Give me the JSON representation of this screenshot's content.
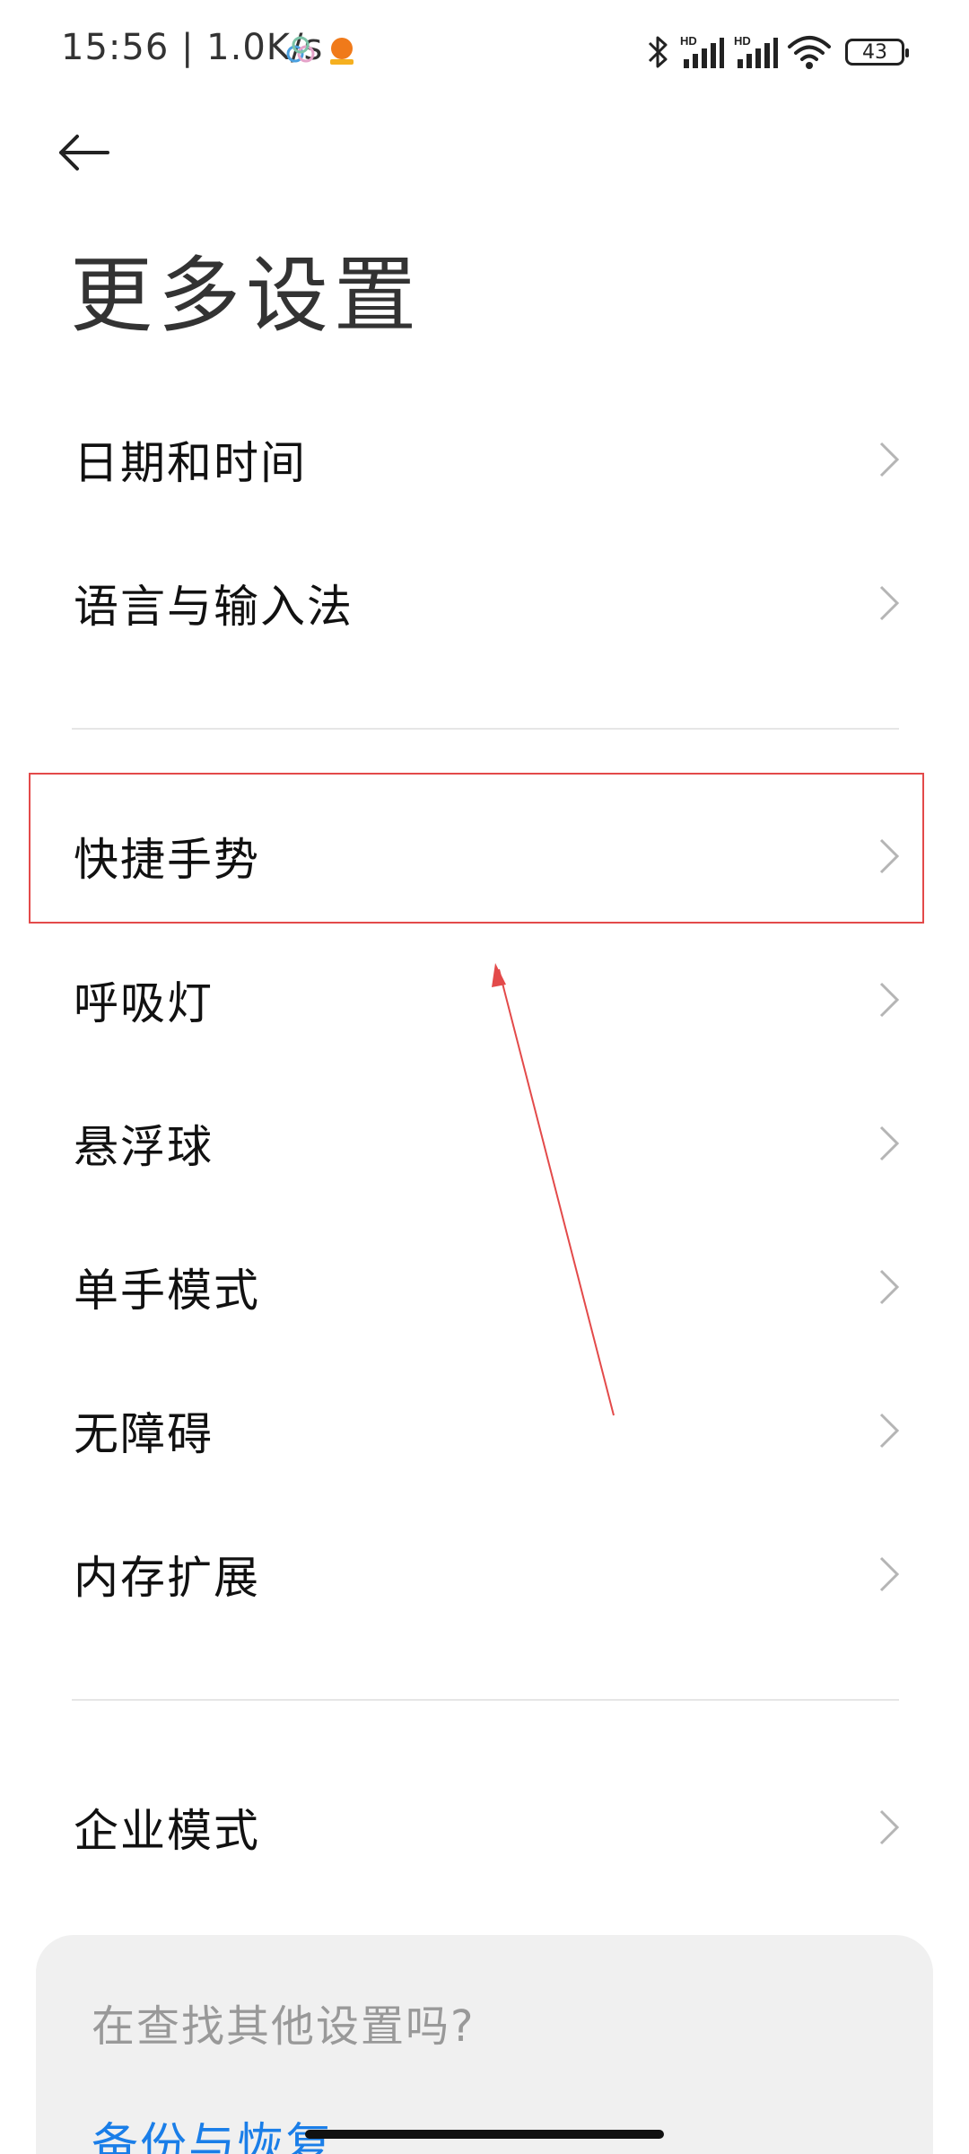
{
  "status_bar": {
    "time_speed": "15:56 | 1.0K/s",
    "signal1_label": "HD",
    "signal2_label": "HD",
    "battery_level": "43"
  },
  "header": {
    "title": "更多设置"
  },
  "group1": {
    "items": [
      {
        "label": "日期和时间"
      },
      {
        "label": "语言与输入法"
      }
    ]
  },
  "group2": {
    "items": [
      {
        "label": "快捷手势"
      },
      {
        "label": "呼吸灯"
      },
      {
        "label": "悬浮球"
      },
      {
        "label": "单手模式"
      },
      {
        "label": "无障碍"
      },
      {
        "label": "内存扩展"
      }
    ]
  },
  "group3": {
    "items": [
      {
        "label": "企业模式"
      }
    ]
  },
  "suggest": {
    "title": "在查找其他设置吗?",
    "link": "备份与恢复"
  },
  "colors": {
    "accent_blue": "#1a7ee8",
    "annotation_red": "#e34a4a"
  },
  "icons": {
    "back": "arrow-left",
    "chevron": "chevron-right",
    "bluetooth": "bluetooth",
    "wifi": "wifi",
    "battery": "battery"
  }
}
